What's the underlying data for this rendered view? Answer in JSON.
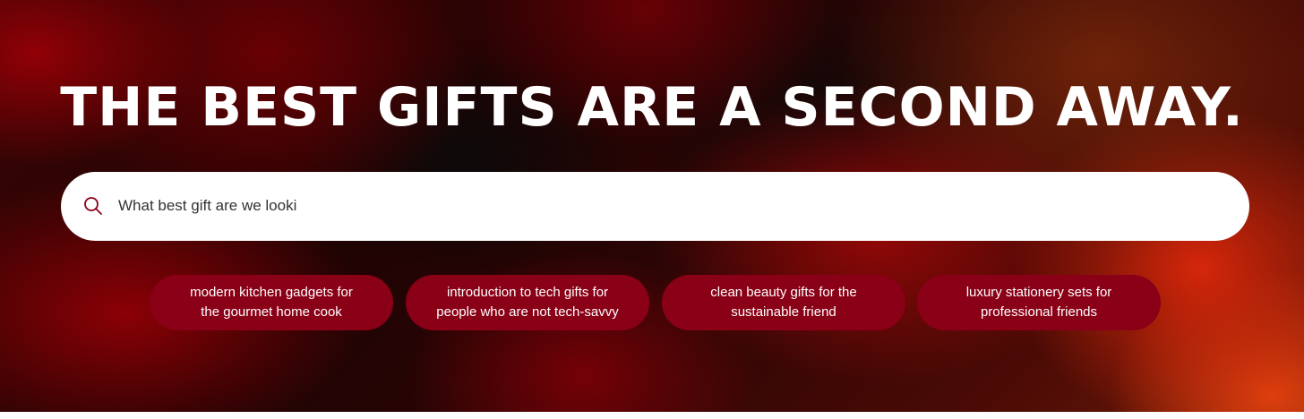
{
  "hero": {
    "title": "THE BEST GIFTS ARE A SECOND AWAY."
  },
  "search": {
    "value": "What best gift are we looki",
    "placeholder": "",
    "icon": "search-icon"
  },
  "suggestions": [
    {
      "line1": "modern kitchen gadgets for",
      "line2": "the gourmet home cook"
    },
    {
      "line1": "introduction to tech gifts for",
      "line2": "people who are not tech-savvy"
    },
    {
      "line1": "clean beauty gifts for the",
      "line2": "sustainable friend"
    },
    {
      "line1": "luxury stationery sets for",
      "line2": "professional friends"
    }
  ],
  "colors": {
    "chip_background": "#8a0016",
    "search_icon": "#8a0016",
    "title_text": "#ffffff"
  }
}
